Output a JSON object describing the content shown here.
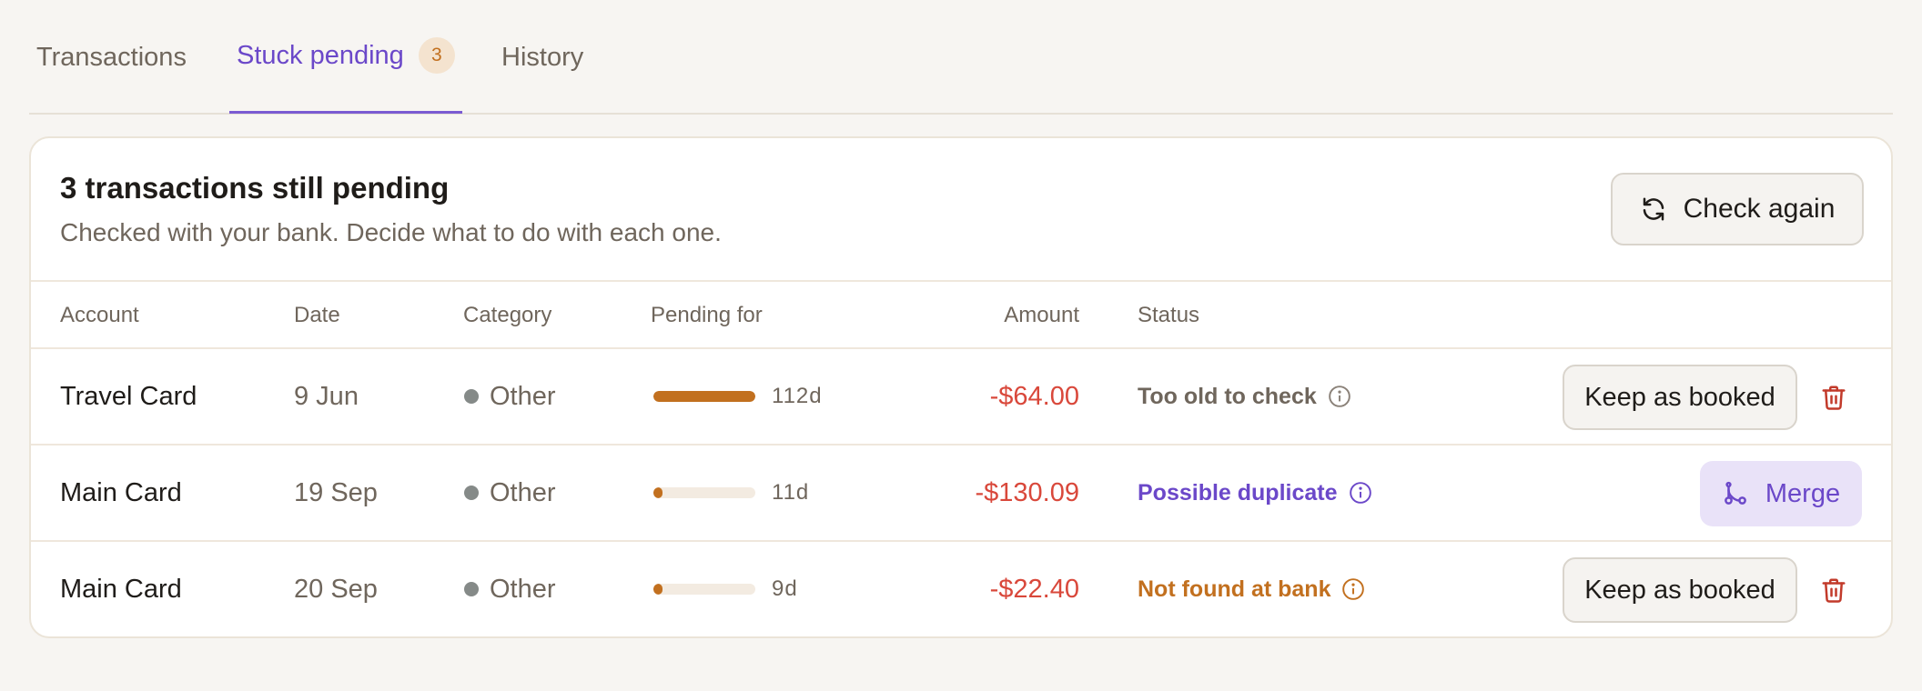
{
  "tabs": [
    {
      "label": "Transactions",
      "active": false
    },
    {
      "label": "Stuck pending",
      "active": true,
      "badge": "3"
    },
    {
      "label": "History",
      "active": false
    }
  ],
  "card": {
    "title": "3 transactions still pending",
    "subtitle": "Checked with your bank. Decide what to do with each one.",
    "check_again_label": "Check again",
    "check_again_icon": "refresh-icon"
  },
  "table": {
    "columns": [
      "Account",
      "Date",
      "Category",
      "Pending for",
      "Amount",
      "Status"
    ],
    "rows": [
      {
        "account": "Travel Card",
        "date": "9 Jun",
        "category": "Other",
        "pending_days": "112d",
        "pending_fraction": 1.0,
        "amount": "-$64.00",
        "status": "Too old to check",
        "status_tone": "gray",
        "action": "Keep as booked",
        "has_delete": true
      },
      {
        "account": "Main Card",
        "date": "19 Sep",
        "category": "Other",
        "pending_days": "11d",
        "pending_fraction": 0.1,
        "amount": "-$130.09",
        "status": "Possible duplicate",
        "status_tone": "purple",
        "action": "Merge",
        "has_delete": false
      },
      {
        "account": "Main Card",
        "date": "20 Sep",
        "category": "Other",
        "pending_days": "9d",
        "pending_fraction": 0.08,
        "amount": "-$22.40",
        "status": "Not found at bank",
        "status_tone": "orange",
        "action": "Keep as booked",
        "has_delete": true
      }
    ]
  },
  "colors": {
    "accent": "#6b48c9",
    "warning": "#c2701f",
    "negative_amount": "#d9483b",
    "category_dot": "#858a88"
  }
}
